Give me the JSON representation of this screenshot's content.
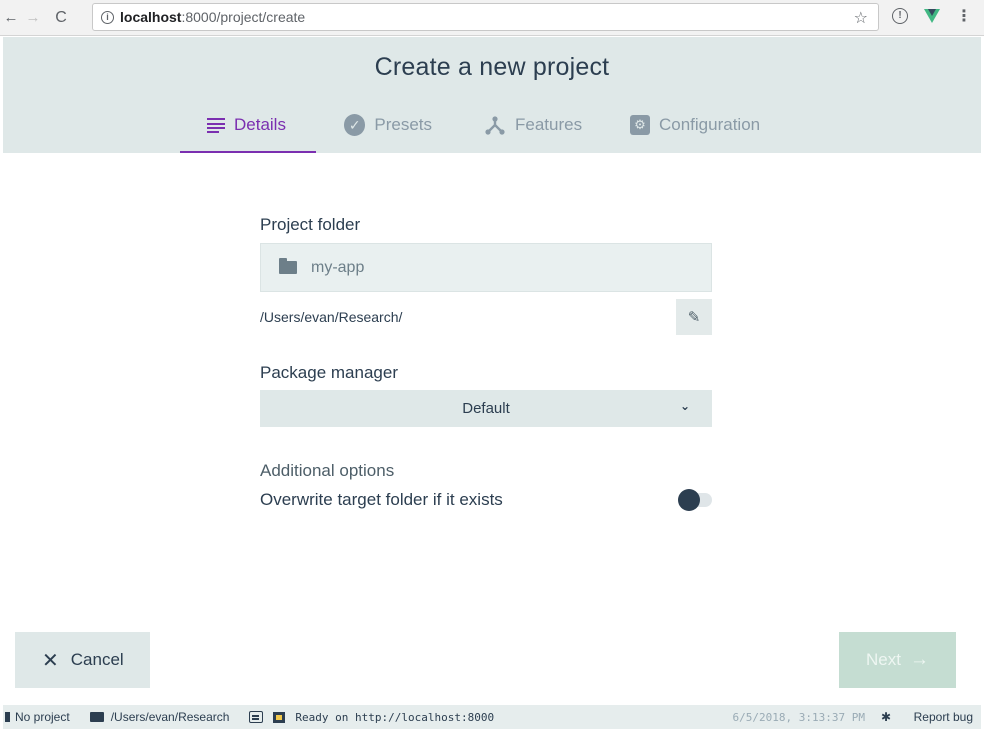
{
  "browser": {
    "url_host": "localhost",
    "url_path": ":8000/project/create"
  },
  "header": {
    "title": "Create a new project",
    "tabs": [
      {
        "label": "Details",
        "icon": "lines-icon",
        "active": true
      },
      {
        "label": "Presets",
        "icon": "check-circle-icon",
        "active": false
      },
      {
        "label": "Features",
        "icon": "fork-icon",
        "active": false
      },
      {
        "label": "Configuration",
        "icon": "cog-icon",
        "active": false
      }
    ]
  },
  "form": {
    "folder_label": "Project folder",
    "folder_value": "my-app",
    "folder_path": "/Users/evan/Research/",
    "package_manager_label": "Package manager",
    "package_manager_value": "Default",
    "additional_options_label": "Additional options",
    "overwrite_label": "Overwrite target folder if it exists",
    "overwrite_enabled": false
  },
  "actions": {
    "cancel_label": "Cancel",
    "next_label": "Next"
  },
  "statusbar": {
    "project": "No project",
    "cwd": "/Users/evan/Research",
    "log": "Ready on http://localhost:8000",
    "timestamp": "6/5/2018, 3:13:37 PM",
    "report_bug": "Report bug"
  },
  "colors": {
    "accent": "#7b2fb0",
    "header_bg": "#dfe8e8",
    "next_disabled": "#c5ddd2",
    "text": "#2c3e50"
  }
}
